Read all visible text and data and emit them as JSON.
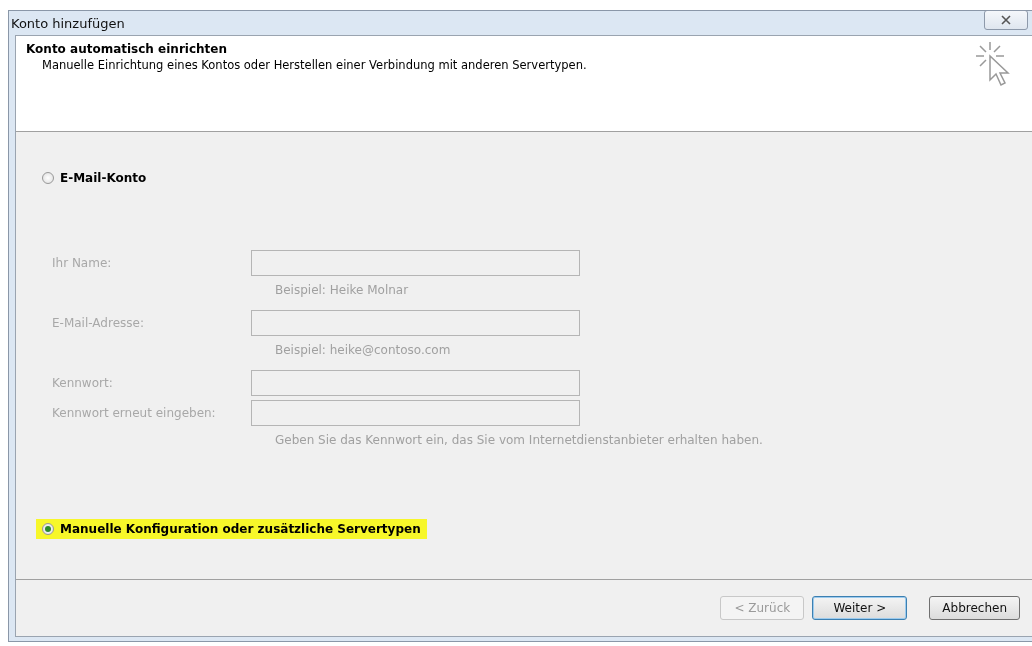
{
  "window": {
    "title": "Konto hinzufügen"
  },
  "header": {
    "title": "Konto automatisch einrichten",
    "subtitle": "Manuelle Einrichtung eines Kontos oder Herstellen einer Verbindung mit anderen Servertypen."
  },
  "options": [
    {
      "label": "E-Mail-Konto",
      "selected": false,
      "highlighted": false
    },
    {
      "label": "Manuelle Konfiguration oder zusätzliche Servertypen",
      "selected": true,
      "highlighted": true
    }
  ],
  "fields": [
    {
      "label": "Ihr Name:",
      "hint": "Beispiel: Heike Molnar",
      "disabled": true
    },
    {
      "label": "E-Mail-Adresse:",
      "hint": "Beispiel: heike@contoso.com",
      "disabled": true
    },
    {
      "label": "Kennwort:",
      "disabled": true
    },
    {
      "label": "Kennwort erneut eingeben:",
      "hint": "Geben Sie das Kennwort ein, das Sie vom Internetdienstanbieter erhalten haben.",
      "disabled": true
    }
  ],
  "buttons": [
    {
      "label": "< Zurück",
      "disabled": true,
      "default": false
    },
    {
      "label": "Weiter >",
      "disabled": false,
      "default": true
    },
    {
      "label": "Abbrechen",
      "disabled": false,
      "default": false
    }
  ]
}
